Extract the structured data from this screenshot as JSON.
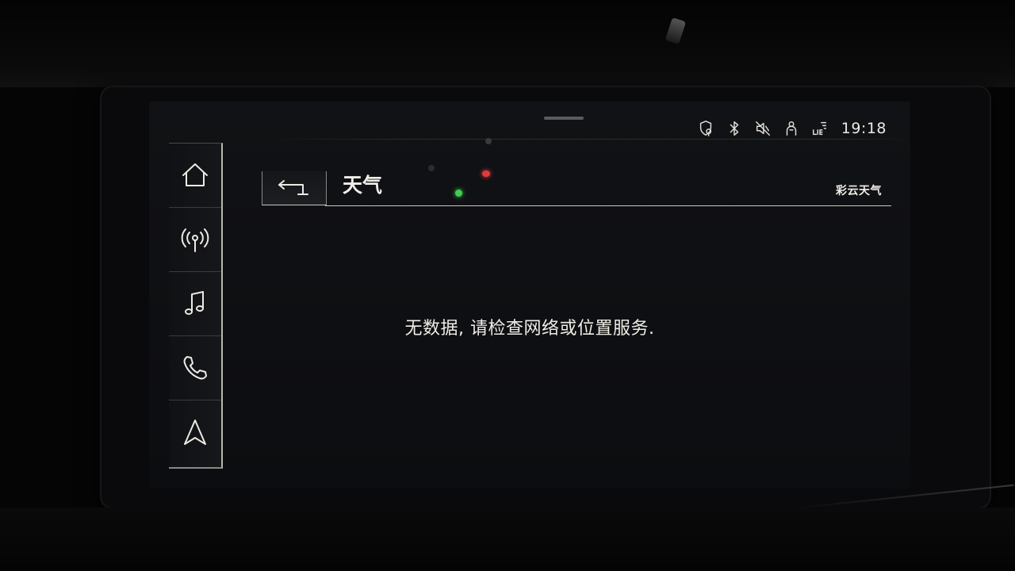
{
  "status_bar": {
    "icons": [
      "location-pin-shield-icon",
      "bluetooth-icon",
      "mute-icon",
      "user-icon",
      "lte-signal-icon"
    ],
    "time": "19:18"
  },
  "rail": {
    "items": [
      {
        "icon": "home-icon"
      },
      {
        "icon": "radio-antenna-icon"
      },
      {
        "icon": "music-note-icon"
      },
      {
        "icon": "phone-icon"
      },
      {
        "icon": "navigation-arrow-icon"
      }
    ]
  },
  "header": {
    "back_icon": "back-arrow-icon",
    "title": "天气",
    "provider": "彩云天气"
  },
  "content": {
    "message": "无数据, 请检查网络或位置服务."
  },
  "colors": {
    "background": "#0e0f12",
    "foreground": "#f0ede6",
    "divider": "#c8c6c0"
  }
}
